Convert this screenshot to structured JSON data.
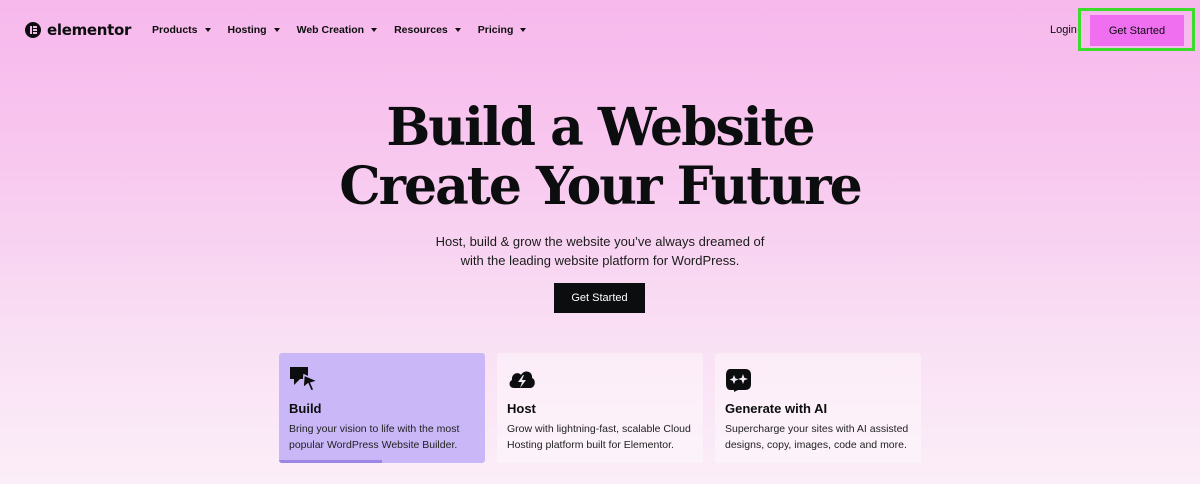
{
  "brand": {
    "name": "elementor"
  },
  "nav": {
    "items": [
      {
        "label": "Products"
      },
      {
        "label": "Hosting"
      },
      {
        "label": "Web Creation"
      },
      {
        "label": "Resources"
      },
      {
        "label": "Pricing"
      }
    ],
    "login_label": "Login",
    "cta_label": "Get Started"
  },
  "hero": {
    "title_line1": "Build a Website",
    "title_line2": "Create Your Future",
    "subtitle_line1": "Host, build & grow the website you’ve always dreamed of",
    "subtitle_line2": "with the leading website platform for WordPress.",
    "cta_label": "Get Started"
  },
  "cards": [
    {
      "title": "Build",
      "description": "Bring your vision to life with the most popular WordPress Website Builder.",
      "icon": "cursor-sparkle-icon",
      "active": true,
      "progress": 0.5
    },
    {
      "title": "Host",
      "description": "Grow with lightning-fast, scalable Cloud Hosting platform built for Elementor.",
      "icon": "cloud-bolt-icon",
      "active": false
    },
    {
      "title": "Generate with AI",
      "description": "Supercharge your sites with AI assisted designs, copy, images, code and more.",
      "icon": "ai-sparkle-icon",
      "active": false
    }
  ],
  "colors": {
    "accent": "#f06ff0",
    "highlight": "#3ddc2c",
    "active_card": "#c9b7f7"
  }
}
